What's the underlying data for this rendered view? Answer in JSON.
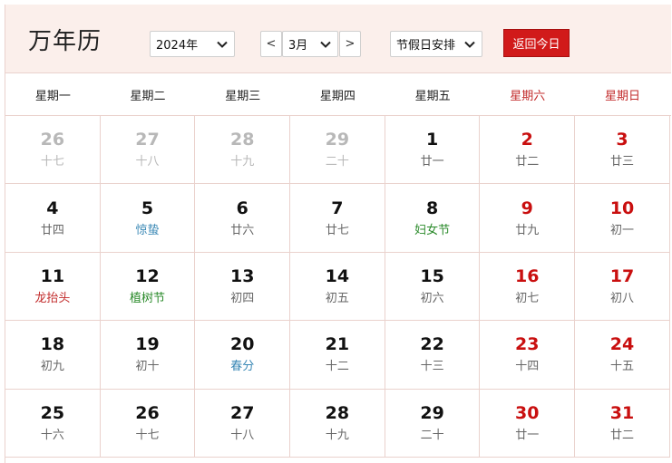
{
  "header": {
    "title": "万年历",
    "year_value": "2024年",
    "month_value": "3月",
    "prev_label": "<",
    "next_label": ">",
    "holiday_value": "节假日安排",
    "today_label": "返回今日"
  },
  "weekdays": [
    "星期一",
    "星期二",
    "星期三",
    "星期四",
    "星期五",
    "星期六",
    "星期日"
  ],
  "colors": {
    "accent": "#d11a1a",
    "header_bg": "#fbefeb",
    "weekend": "#c90f0f",
    "term": "#3a88b5",
    "festival_green": "#2a8a2a"
  },
  "days": [
    {
      "day": "26",
      "lunar": "十七",
      "other": true
    },
    {
      "day": "27",
      "lunar": "十八",
      "other": true
    },
    {
      "day": "28",
      "lunar": "十九",
      "other": true
    },
    {
      "day": "29",
      "lunar": "二十",
      "other": true
    },
    {
      "day": "1",
      "lunar": "廿一"
    },
    {
      "day": "2",
      "lunar": "廿二",
      "weekend": true
    },
    {
      "day": "3",
      "lunar": "廿三",
      "weekend": true
    },
    {
      "day": "4",
      "lunar": "廿四"
    },
    {
      "day": "5",
      "lunar": "惊蛰",
      "kind": "term"
    },
    {
      "day": "6",
      "lunar": "廿六"
    },
    {
      "day": "7",
      "lunar": "廿七"
    },
    {
      "day": "8",
      "lunar": "妇女节",
      "kind": "festival-green"
    },
    {
      "day": "9",
      "lunar": "廿九",
      "weekend": true
    },
    {
      "day": "10",
      "lunar": "初一",
      "weekend": true
    },
    {
      "day": "11",
      "lunar": "龙抬头",
      "kind": "festival-red"
    },
    {
      "day": "12",
      "lunar": "植树节",
      "kind": "festival-green"
    },
    {
      "day": "13",
      "lunar": "初四"
    },
    {
      "day": "14",
      "lunar": "初五"
    },
    {
      "day": "15",
      "lunar": "初六"
    },
    {
      "day": "16",
      "lunar": "初七",
      "weekend": true
    },
    {
      "day": "17",
      "lunar": "初八",
      "weekend": true
    },
    {
      "day": "18",
      "lunar": "初九"
    },
    {
      "day": "19",
      "lunar": "初十"
    },
    {
      "day": "20",
      "lunar": "春分",
      "kind": "term"
    },
    {
      "day": "21",
      "lunar": "十二"
    },
    {
      "day": "22",
      "lunar": "十三"
    },
    {
      "day": "23",
      "lunar": "十四",
      "weekend": true
    },
    {
      "day": "24",
      "lunar": "十五",
      "weekend": true
    },
    {
      "day": "25",
      "lunar": "十六"
    },
    {
      "day": "26",
      "lunar": "十七"
    },
    {
      "day": "27",
      "lunar": "十八"
    },
    {
      "day": "28",
      "lunar": "十九"
    },
    {
      "day": "29",
      "lunar": "二十"
    },
    {
      "day": "30",
      "lunar": "廿一",
      "weekend": true
    },
    {
      "day": "31",
      "lunar": "廿二",
      "weekend": true
    }
  ]
}
